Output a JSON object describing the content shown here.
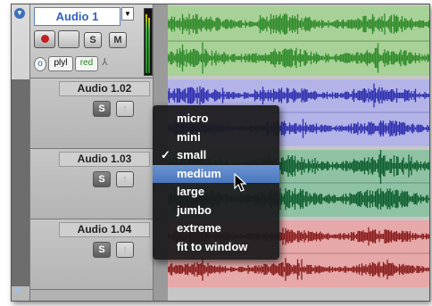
{
  "track_primary": {
    "name": "Audio 1",
    "dropdown_glyph": "▼",
    "solo": "S",
    "mute": "M",
    "voice": "plyl",
    "automation": "red"
  },
  "tracks": [
    {
      "name": "Audio 1.02",
      "solo": "S"
    },
    {
      "name": "Audio 1.03",
      "solo": "S"
    },
    {
      "name": "Audio 1.04",
      "solo": "S"
    }
  ],
  "height_menu": {
    "items": [
      {
        "label": "micro",
        "checked": false
      },
      {
        "label": "mini",
        "checked": false
      },
      {
        "label": "small",
        "checked": true
      },
      {
        "label": "medium",
        "checked": false,
        "highlighted": true
      },
      {
        "label": "large",
        "checked": false
      },
      {
        "label": "jumbo",
        "checked": false
      },
      {
        "label": "extreme",
        "checked": false
      },
      {
        "label": "fit to window",
        "checked": false
      }
    ],
    "check_glyph": "✓"
  },
  "colors": {
    "clip_green_bg": "#a8d197",
    "clip_green_wave": "#2f8a2a",
    "clip_blue_bg": "#b3b3e8",
    "clip_blue_wave": "#2e2fae",
    "clip_teal_bg": "#8fc2a2",
    "clip_teal_wave": "#0f5e30",
    "clip_red_bg": "#e6a8a8",
    "clip_red_wave": "#8a1d1d",
    "menu_highlight": "#5a84c7"
  }
}
